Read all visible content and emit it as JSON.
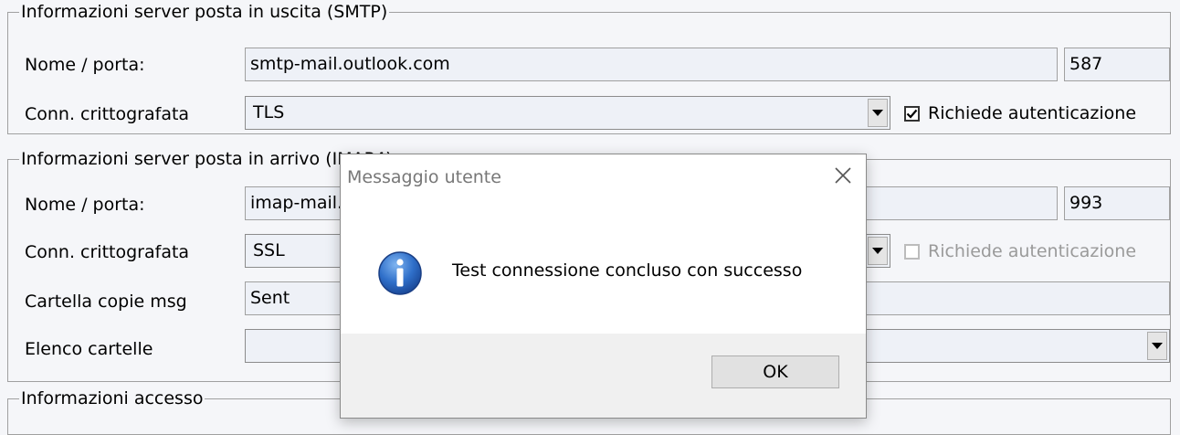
{
  "smtp": {
    "legend": "Informazioni server posta in uscita (SMTP)",
    "name_port_label": "Nome / porta:",
    "server": "smtp-mail.outlook.com",
    "port": "587",
    "encryption_label": "Conn. crittografata",
    "encryption": "TLS",
    "auth_label": "Richiede autenticazione",
    "auth_checked": true
  },
  "imap": {
    "legend": "Informazioni server posta in arrivo (IMAP4)",
    "name_port_label": "Nome / porta:",
    "server": "imap-mail.outlook.com",
    "port": "993",
    "encryption_label": "Conn. crittografata",
    "encryption": "SSL",
    "auth_label": "Richiede autenticazione",
    "auth_checked": false,
    "sent_folder_label": "Cartella copie msg",
    "sent_folder": "Sent",
    "folders_label": "Elenco cartelle",
    "folders": ""
  },
  "access": {
    "legend": "Informazioni accesso"
  },
  "dialog": {
    "title": "Messaggio utente",
    "message": "Test connessione concluso con successo",
    "ok_label": "OK",
    "icon": "info-icon"
  }
}
